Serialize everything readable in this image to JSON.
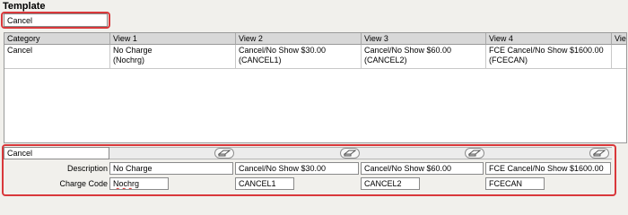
{
  "template": {
    "label": "Template",
    "value": "Cancel"
  },
  "grid": {
    "headers": [
      "Category",
      "View 1",
      "View 2",
      "View 3",
      "View 4",
      "Vie"
    ],
    "rows": [
      {
        "category": "Cancel",
        "views": [
          [
            "No Charge",
            "(Nochrg)"
          ],
          [
            "Cancel/No Show $30.00",
            "(CANCEL1)"
          ],
          [
            "Cancel/No Show $60.00",
            "(CANCEL2)"
          ],
          [
            "FCE Cancel/No Show $1600.00",
            "(FCECAN)"
          ]
        ]
      }
    ]
  },
  "editor": {
    "category_value": "Cancel",
    "description_label": "Description",
    "charge_code_label": "Charge Code",
    "descriptions": [
      "No Charge",
      "Cancel/No Show $30.00",
      "Cancel/No Show $60.00",
      "FCE Cancel/No Show $1600.00"
    ],
    "charge_codes": [
      "Nochrg",
      "CANCEL1",
      "CANCEL2",
      "FCECAN"
    ]
  },
  "icons": {
    "clear": "eraser-icon"
  },
  "colors": {
    "highlight": "#d9383b",
    "header_bg": "#d8d8d8",
    "panel_bg": "#f1f0ec"
  }
}
